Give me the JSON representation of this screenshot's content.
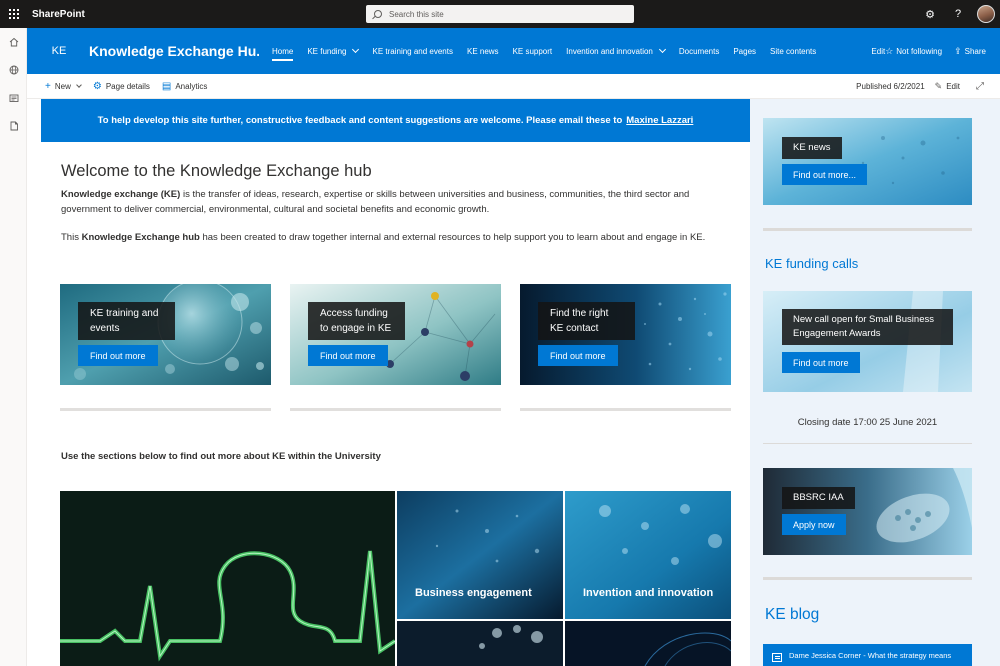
{
  "suite": {
    "brand": "SharePoint",
    "search_placeholder": "Search this site",
    "settings_glyph": "⚙",
    "help_glyph": "?"
  },
  "site": {
    "logo": "KE",
    "title": "Knowledge Exchange Hu...",
    "nav": [
      {
        "label": "Home",
        "active": true,
        "has_menu": false
      },
      {
        "label": "KE funding",
        "active": false,
        "has_menu": true
      },
      {
        "label": "KE training and events",
        "active": false,
        "has_menu": false
      },
      {
        "label": "KE news",
        "active": false,
        "has_menu": false
      },
      {
        "label": "KE support",
        "active": false,
        "has_menu": false
      },
      {
        "label": "Invention and innovation",
        "active": false,
        "has_menu": true
      },
      {
        "label": "Documents",
        "active": false,
        "has_menu": false
      },
      {
        "label": "Pages",
        "active": false,
        "has_menu": false
      },
      {
        "label": "Site contents",
        "active": false,
        "has_menu": false
      },
      {
        "label": "Edit",
        "active": false,
        "has_menu": false
      }
    ],
    "follow_label": "Not following",
    "share_label": "Share",
    "accent": "#0078d4"
  },
  "commandbar": {
    "new_label": "New",
    "page_details_label": "Page details",
    "analytics_label": "Analytics",
    "published": "Published 6/2/2021",
    "edit_label": "Edit"
  },
  "banner": {
    "text": "To help develop this site further, constructive feedback and content suggestions are welcome.  Please email these to",
    "link": "Maxine Lazzari"
  },
  "welcome": {
    "title": "Welcome to the Knowledge Exchange hub",
    "p1_bold": "Knowledge exchange (KE)",
    "p1_rest": " is the transfer of ideas, research, expertise or skills between universities and business, communities, the third sector and government to deliver commercial, environmental, cultural and societal benefits and economic growth.",
    "p2_pre": "This ",
    "p2_bold": "Knowledge Exchange hub",
    "p2_rest": " has been created to draw together internal and external resources to help support you to learn about and engage in KE."
  },
  "tiles": [
    {
      "title": "KE training and events",
      "button": "Find out more"
    },
    {
      "title": "Access funding to engage in KE",
      "button": "Find out more"
    },
    {
      "title": "Find the right KE contact",
      "button": "Find out more"
    }
  ],
  "sections_intro": "Use the sections below to find out more about KE within the University",
  "sections": [
    {
      "label": "Business engagement"
    },
    {
      "label": "Invention and innovation"
    }
  ],
  "sidebar": {
    "news": {
      "label": "KE news",
      "button": "Find out more..."
    },
    "funding_heading": "KE funding calls",
    "funding_card": {
      "label": "New call open for Small Business Engagement Awards",
      "button": "Find out more"
    },
    "closing": "Closing date 17:00 25 June 2021",
    "bbsrc": {
      "label": "BBSRC IAA",
      "button": "Apply now"
    },
    "blog_heading": "KE blog",
    "blog_item": "Dame Jessica Corner - What the strategy means"
  }
}
